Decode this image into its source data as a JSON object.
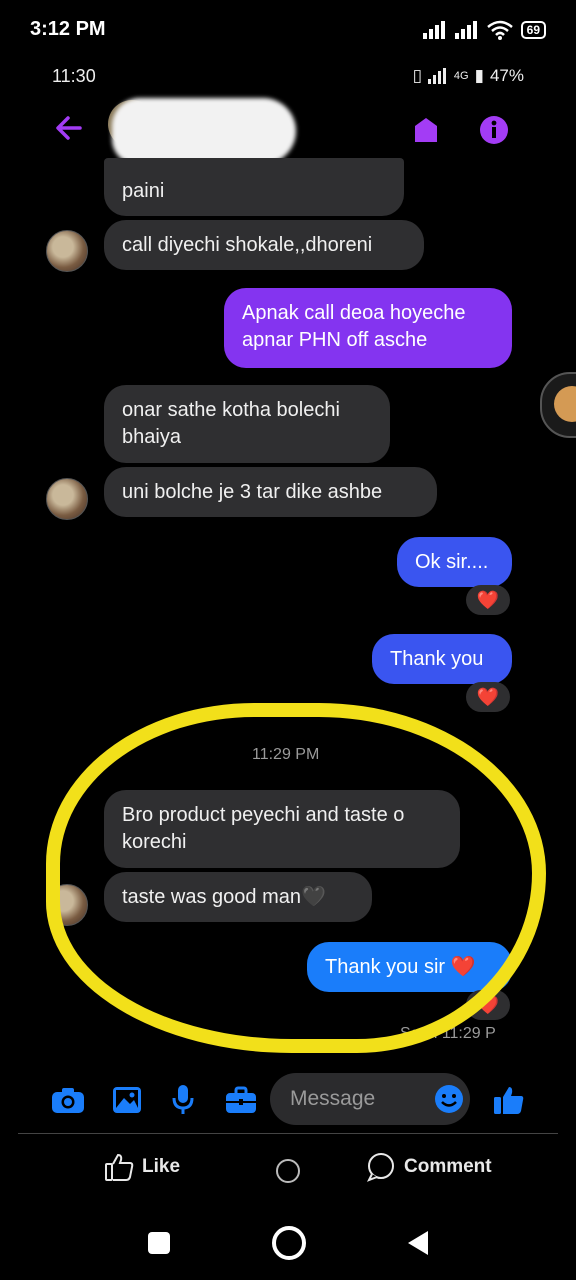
{
  "status_bar": {
    "time": "3:12 PM",
    "battery": "69"
  },
  "inner_status": {
    "time": "11:30",
    "battery_text": "47%",
    "network": "4G"
  },
  "header": {
    "icons": [
      "back-arrow-icon",
      "tag-icon",
      "info-icon"
    ]
  },
  "messages": [
    {
      "text": "paini",
      "type": "received"
    },
    {
      "text": "call diyechi shokale,,dhoreni",
      "type": "received"
    },
    {
      "text": "Apnak call deoa hoyeche apnar PHN off asche",
      "type": "sent"
    },
    {
      "text": "onar sathe kotha bolechi bhaiya",
      "type": "received"
    },
    {
      "text": "uni bolche je 3 tar dike ashbe",
      "type": "received"
    },
    {
      "text": "Ok sir....",
      "type": "sent"
    },
    {
      "text": "Thank you",
      "type": "sent"
    },
    {
      "text": "Bro product peyechi and taste o korechi",
      "type": "received"
    },
    {
      "text": "taste was good man🖤",
      "type": "received"
    },
    {
      "text": "Thank you sir ❤️",
      "type": "sent"
    }
  ],
  "timestamp": "11:29 PM",
  "reaction": "❤️",
  "seen": "Seen 11:29 P",
  "composer": {
    "placeholder": "Message"
  },
  "post_actions": {
    "like": "Like",
    "comment": "Comment"
  },
  "colors": {
    "highlight": "#f2e01a",
    "sent_purple": "#8434f0",
    "sent_blue": "#3a55f0",
    "sent_light_blue": "#1a7dfa",
    "accent": "#1a7dfa"
  }
}
